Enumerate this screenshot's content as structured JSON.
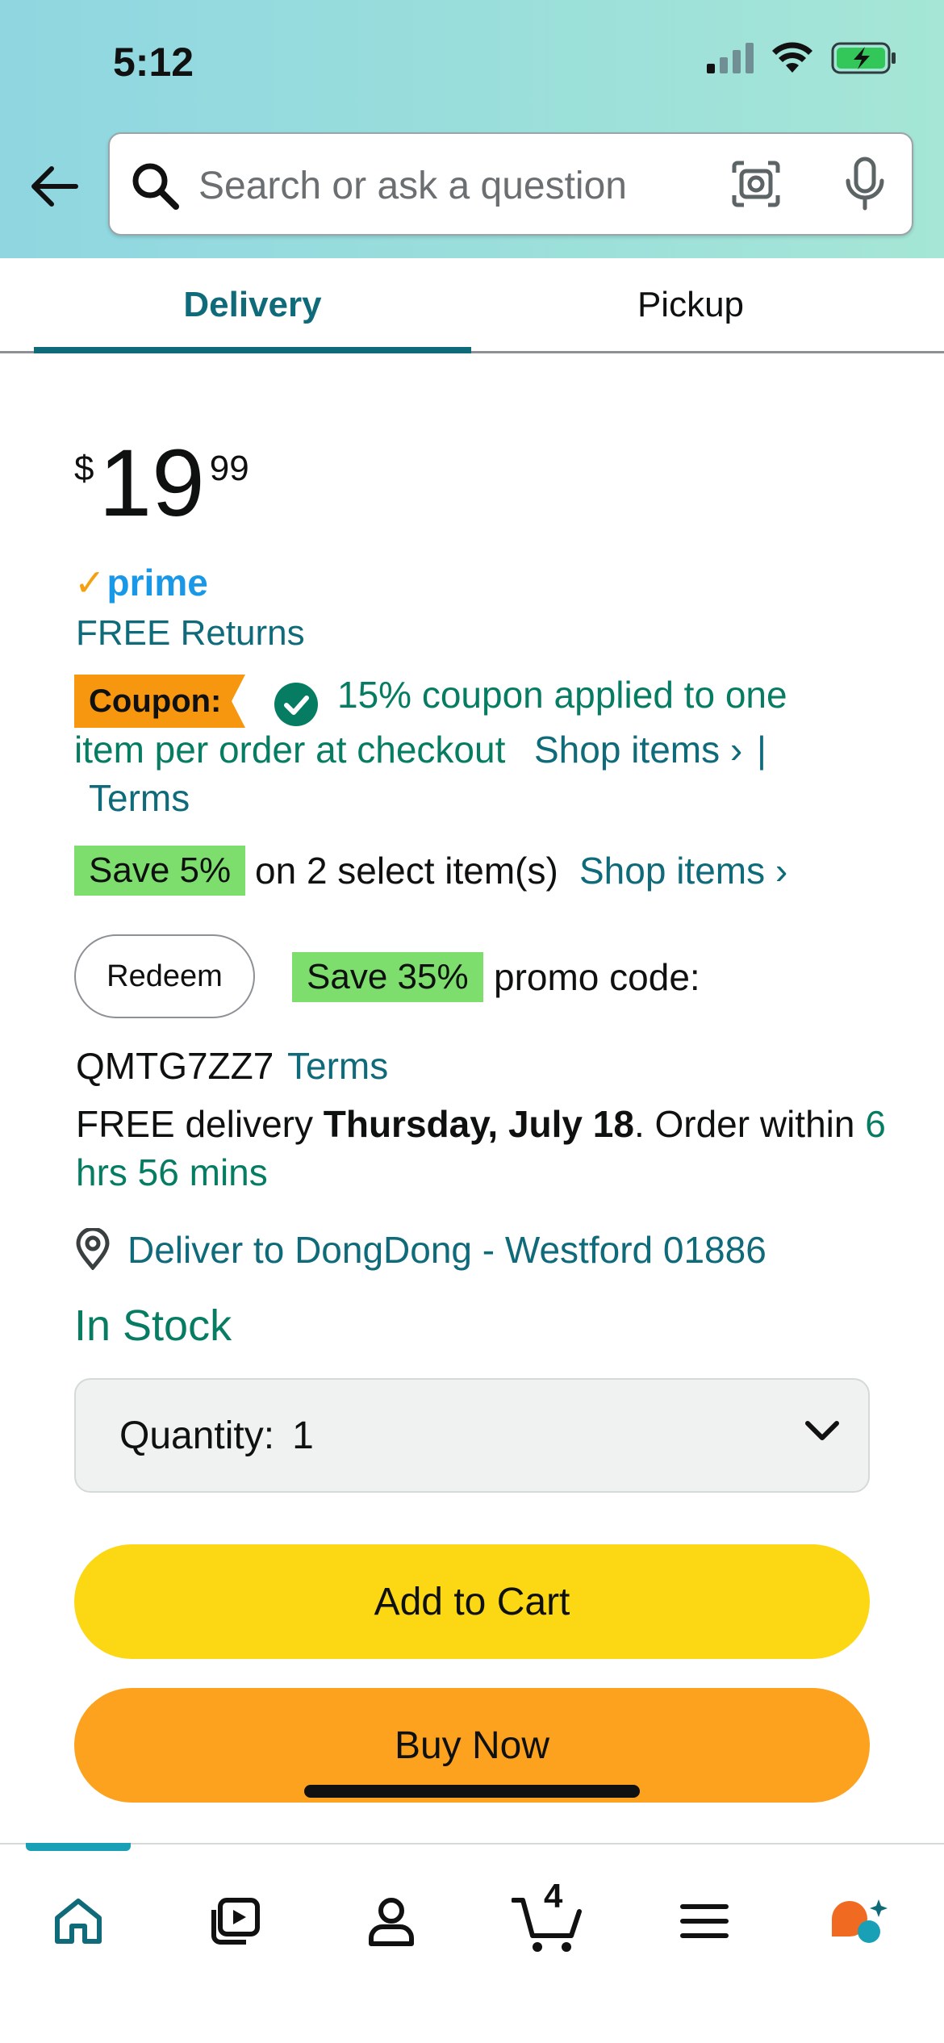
{
  "status_bar": {
    "time": "5:12"
  },
  "search": {
    "placeholder": "Search or ask a question"
  },
  "tabs": [
    {
      "label": "Delivery",
      "selected": true
    },
    {
      "label": "Pickup",
      "selected": false
    }
  ],
  "price": {
    "symbol": "$",
    "whole": "19",
    "fraction": "99"
  },
  "prime": {
    "label": "prime"
  },
  "free_returns": "FREE Returns",
  "coupon": {
    "tag": "Coupon:",
    "text_line1": "15% coupon applied to one",
    "text_line2": "item per order at checkout",
    "shop_items": "Shop items ›",
    "separator": "|",
    "terms": "Terms"
  },
  "save5": {
    "badge": "Save 5%",
    "text": "on 2 select item(s)",
    "shop_items": "Shop items ›"
  },
  "promo": {
    "redeem": "Redeem",
    "badge": "Save 35%",
    "text": "promo code:",
    "code": "QMTG7ZZ7",
    "terms": "Terms"
  },
  "delivery": {
    "prefix": "FREE delivery",
    "date": "Thursday, July 18",
    "order_within": ". Order within",
    "time_left_1": "6",
    "time_left_2": "hrs 56 mins"
  },
  "deliver_to": "Deliver to DongDong - Westford 01886",
  "stock": "In Stock",
  "quantity": {
    "label": "Quantity:",
    "value": "1"
  },
  "buttons": {
    "add_to_cart": "Add to Cart",
    "buy_now": "Buy Now"
  },
  "bottom_nav": {
    "items": [
      "home-icon",
      "video-icon",
      "account-icon",
      "cart-icon",
      "menu-icon",
      "rufus-icon"
    ],
    "cart_count": "4"
  },
  "colors": {
    "teal": "#0f6a7a",
    "green": "#067d62",
    "yellow": "#fcd714",
    "orange": "#fca21e",
    "badge_green": "#7dde6d",
    "coupon_orange": "#f7960f"
  }
}
